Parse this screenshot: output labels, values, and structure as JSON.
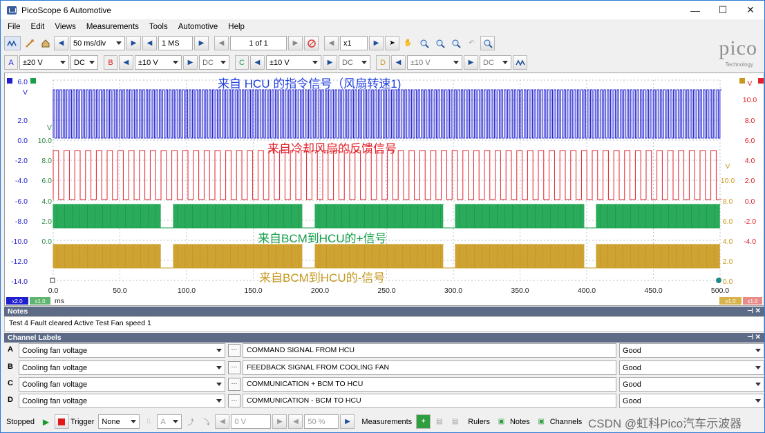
{
  "window": {
    "title": "PicoScope 6 Automotive",
    "controls": [
      "—",
      "☐",
      "✕"
    ]
  },
  "menu": [
    "File",
    "Edit",
    "Views",
    "Measurements",
    "Tools",
    "Automotive",
    "Help"
  ],
  "toolbar": {
    "timebase": "50 ms/div",
    "samples": "1 MS",
    "buffer": "1 of 1",
    "zoom": "x1"
  },
  "channels_bar": [
    {
      "id": "A",
      "range": "±20 V",
      "coupling": "DC",
      "color": "#1f1fd0"
    },
    {
      "id": "B",
      "range": "±10 V",
      "coupling": "DC",
      "color": "#e0202a"
    },
    {
      "id": "C",
      "range": "±10 V",
      "coupling": "DC",
      "color": "#1fa04a"
    },
    {
      "id": "D",
      "range": "±10 V",
      "coupling": "DC",
      "color": "#c79a1e"
    }
  ],
  "logo": {
    "word": "pico",
    "sub": "Technology"
  },
  "scope": {
    "overlays": {
      "a": "来自 HCU 的指令信号（风扇转速1)",
      "b": "来自冷却风扇的反馈信号",
      "c": "来自BCM到HCU的+信号",
      "d": "来自BCM到HCU的-信号"
    },
    "axis_a_ticks": [
      "6.0",
      "V",
      "2.0",
      "0.0",
      "-2.0",
      "-4.0",
      "-6.0",
      "-8.0",
      "-10.0",
      "-12.0",
      "-14.0"
    ],
    "axis_b_ticks": [
      "V",
      "10.0",
      "8.0",
      "6.0",
      "4.0",
      "2.0",
      "0.0",
      "-2.0",
      "-4.0"
    ],
    "axis_c_ticks": [
      "V",
      "10.0",
      "8.0",
      "6.0",
      "4.0",
      "2.0",
      "0.0"
    ],
    "axis_d_ticks": [
      "V",
      "10.0",
      "8.0",
      "6.0",
      "4.0",
      "2.0",
      "0.0",
      "-2.0",
      "-4.0",
      "-6.0",
      "-8.0"
    ],
    "x_ticks": [
      "0.0",
      "50.0",
      "100.0",
      "150.0",
      "200.0",
      "250.0",
      "300.0",
      "350.0",
      "400.0",
      "450.0",
      "500.0"
    ],
    "x_unit": "ms",
    "scale_badges": {
      "a": "x2.0",
      "c": "x1.0",
      "d": "x1.0",
      "b": "x1.0"
    }
  },
  "notes": {
    "title": "Notes",
    "text": "Test 4 Fault cleared Active Test Fan speed 1"
  },
  "channel_labels": {
    "title": "Channel Labels",
    "rows": [
      {
        "ch": "A",
        "probe": "Cooling fan voltage",
        "desc": "COMMAND SIGNAL FROM HCU",
        "status": "Good"
      },
      {
        "ch": "B",
        "probe": "Cooling fan voltage",
        "desc": "FEEDBACK SIGNAL FROM COOLING FAN",
        "status": "Good"
      },
      {
        "ch": "C",
        "probe": "Cooling fan voltage",
        "desc": "COMMUNICATION + BCM TO HCU",
        "status": "Good"
      },
      {
        "ch": "D",
        "probe": "Cooling fan voltage",
        "desc": "COMMUNICATION - BCM TO HCU",
        "status": "Good"
      }
    ]
  },
  "status": {
    "state": "Stopped",
    "trigger_label": "Trigger",
    "trigger_mode": "None",
    "trigger_channel": "A",
    "trigger_level": "0 V",
    "pretrigger": "50 %",
    "measurements": "Measurements",
    "rulers": "Rulers",
    "notes": "Notes",
    "channels": "Channels"
  },
  "watermark": "CSDN @虹科Pico汽车示波器",
  "colors": {
    "a": "#1f1fd0",
    "b": "#e0202a",
    "c": "#15a04a",
    "d": "#c8991e"
  }
}
